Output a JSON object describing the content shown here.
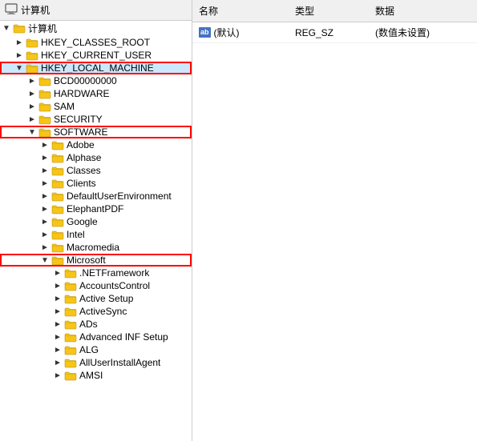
{
  "header": {
    "computer_label": "计算机"
  },
  "columns": {
    "name": "名称",
    "type": "类型",
    "data": "数据"
  },
  "detail_row": {
    "name_icon": "ab",
    "name_text": "(默认)",
    "type": "REG_SZ",
    "data": "(数值未设置)"
  },
  "tree": {
    "items": [
      {
        "id": "computer",
        "label": "计算机",
        "indent": 0,
        "arrow": "chevron-down",
        "expanded": true,
        "highlighted": false,
        "outlined": false
      },
      {
        "id": "hkey_classes_root",
        "label": "HKEY_CLASSES_ROOT",
        "indent": 1,
        "arrow": "chevron-right",
        "expanded": false,
        "highlighted": false,
        "outlined": false
      },
      {
        "id": "hkey_current_user",
        "label": "HKEY_CURRENT_USER",
        "indent": 1,
        "arrow": "chevron-right",
        "expanded": false,
        "highlighted": false,
        "outlined": false
      },
      {
        "id": "hkey_local_machine",
        "label": "HKEY_LOCAL_MACHINE",
        "indent": 1,
        "arrow": "chevron-down",
        "expanded": true,
        "highlighted": true,
        "outlined": true
      },
      {
        "id": "bcd00000000",
        "label": "BCD00000000",
        "indent": 2,
        "arrow": "chevron-right",
        "expanded": false,
        "highlighted": false,
        "outlined": false
      },
      {
        "id": "hardware",
        "label": "HARDWARE",
        "indent": 2,
        "arrow": "chevron-right",
        "expanded": false,
        "highlighted": false,
        "outlined": false
      },
      {
        "id": "sam",
        "label": "SAM",
        "indent": 2,
        "arrow": "chevron-right",
        "expanded": false,
        "highlighted": false,
        "outlined": false
      },
      {
        "id": "security",
        "label": "SECURITY",
        "indent": 2,
        "arrow": "chevron-right",
        "expanded": false,
        "highlighted": false,
        "outlined": false
      },
      {
        "id": "software",
        "label": "SOFTWARE",
        "indent": 2,
        "arrow": "chevron-down",
        "expanded": true,
        "highlighted": false,
        "outlined": true
      },
      {
        "id": "adobe",
        "label": "Adobe",
        "indent": 3,
        "arrow": "chevron-right",
        "expanded": false,
        "highlighted": false,
        "outlined": false
      },
      {
        "id": "alphase",
        "label": "Alphase",
        "indent": 3,
        "arrow": "chevron-right",
        "expanded": false,
        "highlighted": false,
        "outlined": false
      },
      {
        "id": "classes",
        "label": "Classes",
        "indent": 3,
        "arrow": "chevron-right",
        "expanded": false,
        "highlighted": false,
        "outlined": false
      },
      {
        "id": "clients",
        "label": "Clients",
        "indent": 3,
        "arrow": "chevron-right",
        "expanded": false,
        "highlighted": false,
        "outlined": false
      },
      {
        "id": "defaultuserenvironment",
        "label": "DefaultUserEnvironment",
        "indent": 3,
        "arrow": "chevron-right",
        "expanded": false,
        "highlighted": false,
        "outlined": false
      },
      {
        "id": "elephantpdf",
        "label": "ElephantPDF",
        "indent": 3,
        "arrow": "chevron-right",
        "expanded": false,
        "highlighted": false,
        "outlined": false
      },
      {
        "id": "google",
        "label": "Google",
        "indent": 3,
        "arrow": "chevron-right",
        "expanded": false,
        "highlighted": false,
        "outlined": false
      },
      {
        "id": "intel",
        "label": "Intel",
        "indent": 3,
        "arrow": "chevron-right",
        "expanded": false,
        "highlighted": false,
        "outlined": false
      },
      {
        "id": "macromedia",
        "label": "Macromedia",
        "indent": 3,
        "arrow": "chevron-right",
        "expanded": false,
        "highlighted": false,
        "outlined": false
      },
      {
        "id": "microsoft",
        "label": "Microsoft",
        "indent": 3,
        "arrow": "chevron-down",
        "expanded": true,
        "highlighted": false,
        "outlined": true
      },
      {
        "id": "netframework",
        "label": ".NETFramework",
        "indent": 4,
        "arrow": "chevron-right",
        "expanded": false,
        "highlighted": false,
        "outlined": false
      },
      {
        "id": "accountscontrol",
        "label": "AccountsControl",
        "indent": 4,
        "arrow": "chevron-right",
        "expanded": false,
        "highlighted": false,
        "outlined": false
      },
      {
        "id": "active_setup",
        "label": "Active Setup",
        "indent": 4,
        "arrow": "chevron-right",
        "expanded": false,
        "highlighted": false,
        "outlined": false
      },
      {
        "id": "activesync",
        "label": "ActiveSync",
        "indent": 4,
        "arrow": "chevron-right",
        "expanded": false,
        "highlighted": false,
        "outlined": false
      },
      {
        "id": "ads",
        "label": "ADs",
        "indent": 4,
        "arrow": "chevron-right",
        "expanded": false,
        "highlighted": false,
        "outlined": false
      },
      {
        "id": "advanced_inf_setup",
        "label": "Advanced INF Setup",
        "indent": 4,
        "arrow": "chevron-right",
        "expanded": false,
        "highlighted": false,
        "outlined": false
      },
      {
        "id": "alg",
        "label": "ALG",
        "indent": 4,
        "arrow": "chevron-right",
        "expanded": false,
        "highlighted": false,
        "outlined": false
      },
      {
        "id": "alluserinstallagent",
        "label": "AllUserInstallAgent",
        "indent": 4,
        "arrow": "chevron-right",
        "expanded": false,
        "highlighted": false,
        "outlined": false
      },
      {
        "id": "amsi",
        "label": "AMSI",
        "indent": 4,
        "arrow": "chevron-right",
        "expanded": false,
        "highlighted": false,
        "outlined": false
      }
    ]
  }
}
